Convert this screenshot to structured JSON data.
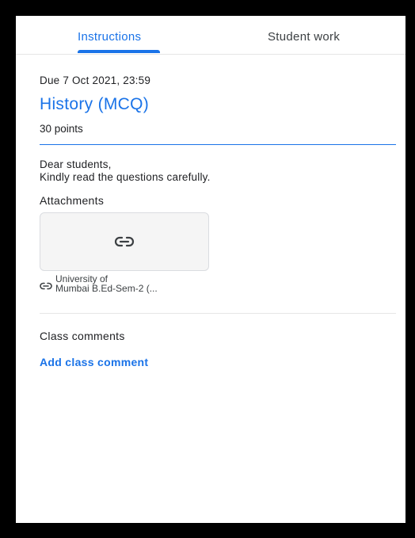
{
  "tabs": {
    "instructions": "Instructions",
    "student_work": "Student work"
  },
  "assignment": {
    "due": "Due 7 Oct 2021, 23:59",
    "title": "History (MCQ)",
    "points": "30 points",
    "description_line1": "Dear students,",
    "description_line2": "Kindly read the questions carefully."
  },
  "attachments": {
    "heading": "Attachments",
    "items": [
      {
        "icon": "link-icon",
        "name_line1": "University of",
        "name_line2": "Mumbai B.Ed-Sem-2 (..."
      }
    ]
  },
  "comments": {
    "heading": "Class comments",
    "add_label": "Add class comment"
  },
  "colors": {
    "accent": "#1a73e8",
    "text": "#202124",
    "frame": "#000000"
  }
}
